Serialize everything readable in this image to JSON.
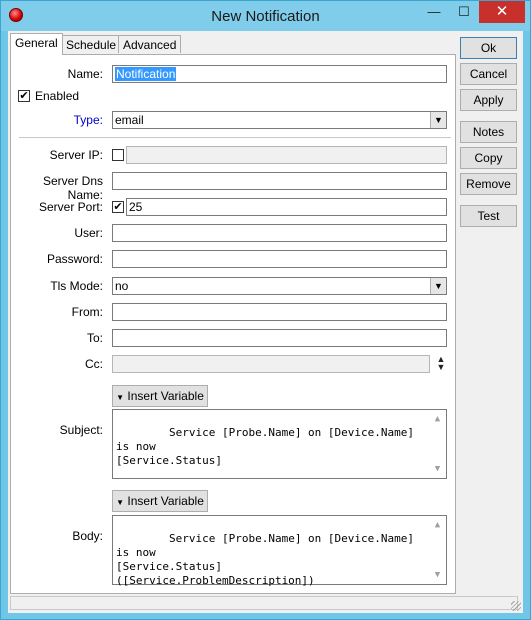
{
  "window": {
    "title": "New Notification"
  },
  "titlebar": {
    "minimize": "—",
    "maximize": "☐",
    "close": "✕"
  },
  "tabs": [
    {
      "label": "General",
      "active": true
    },
    {
      "label": "Schedule",
      "active": false
    },
    {
      "label": "Advanced",
      "active": false
    }
  ],
  "form": {
    "name_label": "Name:",
    "name_value": "Notification",
    "enabled_label": "Enabled",
    "enabled_checked": true,
    "type_label": "Type:",
    "type_value": "email",
    "server_ip_label": "Server IP:",
    "server_ip_checked": false,
    "server_ip_value": "",
    "server_dns_label": "Server Dns Name:",
    "server_dns_value": "",
    "server_port_label": "Server Port:",
    "server_port_checked": true,
    "server_port_value": "25",
    "user_label": "User:",
    "user_value": "",
    "password_label": "Password:",
    "password_value": "",
    "tls_label": "Tls Mode:",
    "tls_value": "no",
    "from_label": "From:",
    "from_value": "",
    "to_label": "To:",
    "to_value": "",
    "cc_label": "Cc:",
    "cc_value": "",
    "insert_variable_label": "Insert Variable",
    "subject_label": "Subject:",
    "subject_value": "Service [Probe.Name] on [Device.Name] is now\n[Service.Status]",
    "body_label": "Body:",
    "body_value": "Service [Probe.Name] on [Device.Name] is now\n[Service.Status]\n([Service.ProblemDescription])"
  },
  "buttons": {
    "ok": "Ok",
    "cancel": "Cancel",
    "apply": "Apply",
    "notes": "Notes",
    "copy": "Copy",
    "remove": "Remove",
    "test": "Test"
  },
  "colors": {
    "titlebar": "#7fcdeb",
    "close": "#c7302b",
    "type_label": "#0000cc"
  }
}
